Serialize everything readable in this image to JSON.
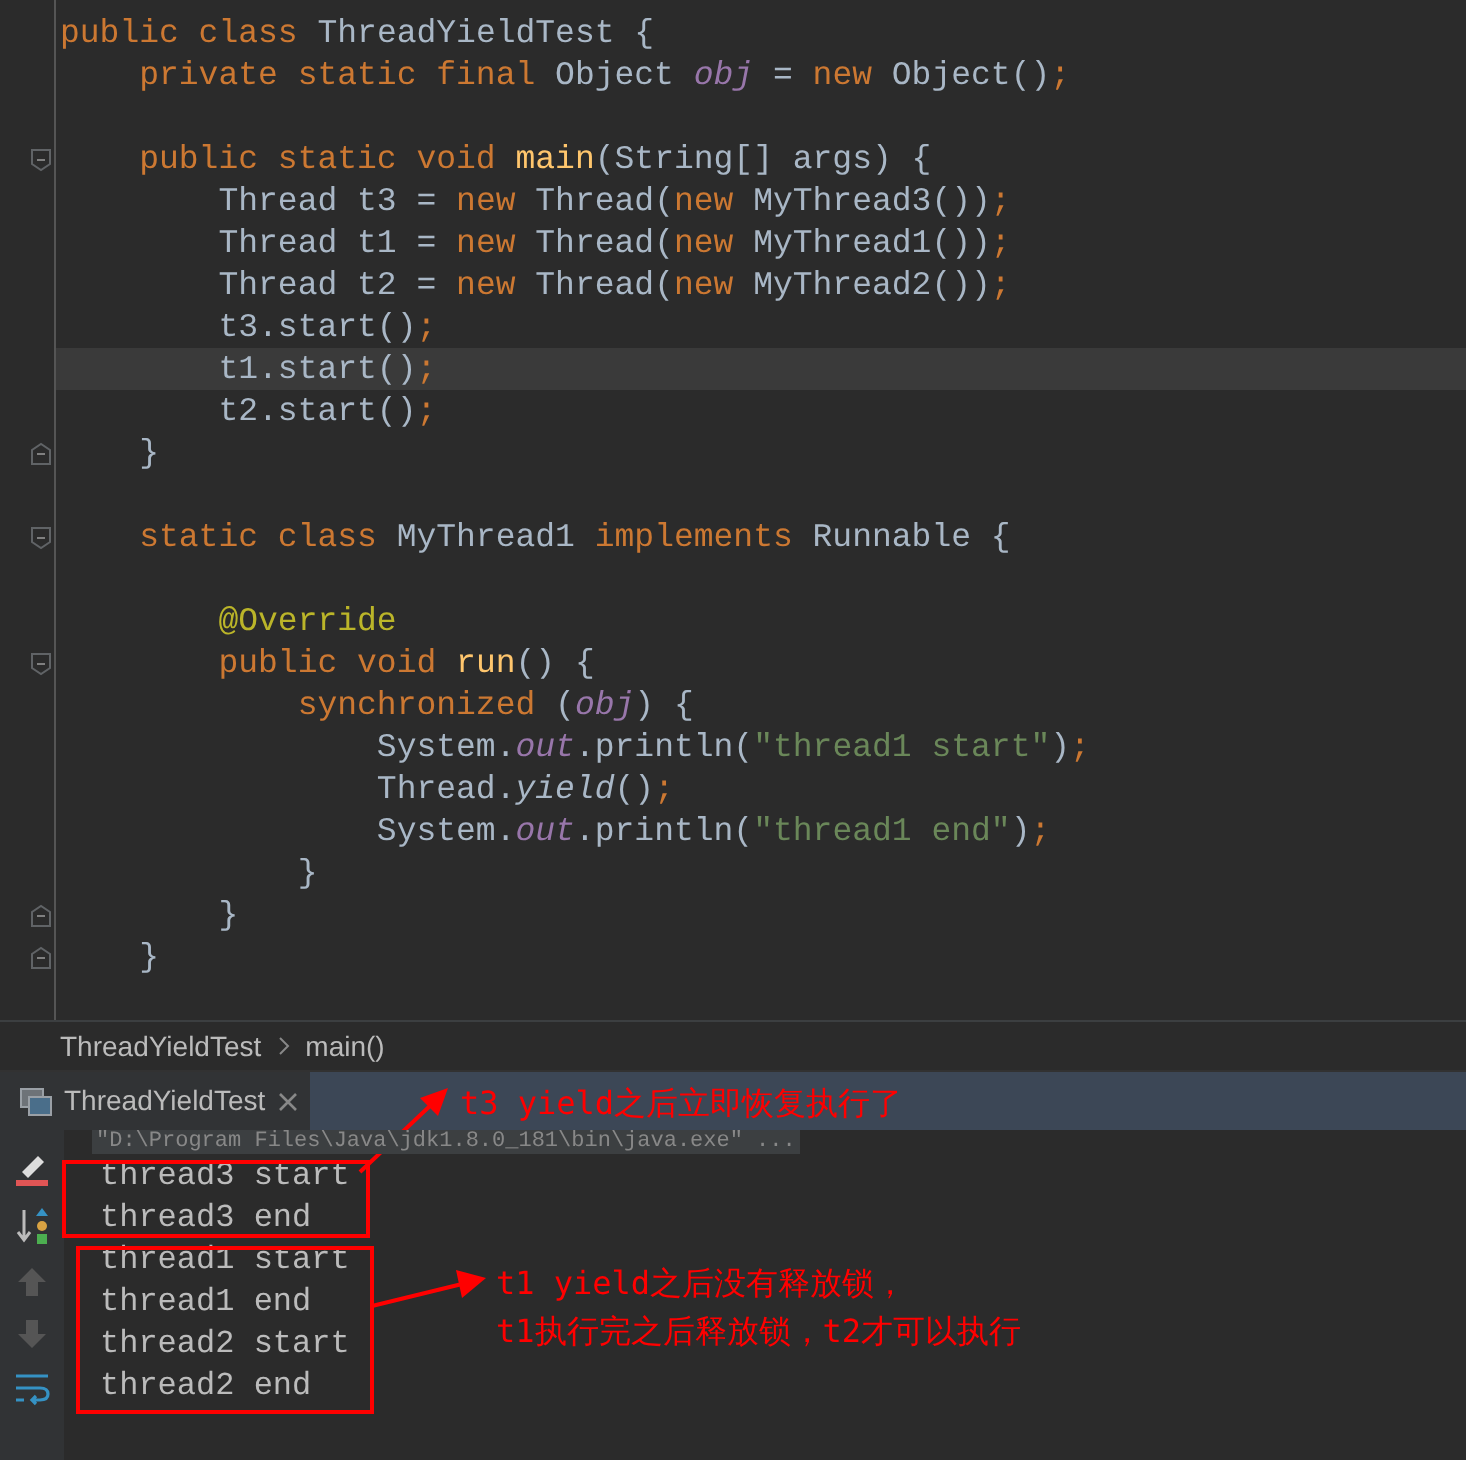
{
  "editor": {
    "lines": [
      {
        "tokens": [
          {
            "kind": "keyword",
            "text": "public class "
          },
          {
            "kind": "plain",
            "text": "ThreadYieldTest {"
          }
        ]
      },
      {
        "tokens": [
          {
            "kind": "keyword",
            "text": "    private static final "
          },
          {
            "kind": "plain",
            "text": "Object "
          },
          {
            "kind": "field",
            "text": "obj"
          },
          {
            "kind": "plain",
            "text": " = "
          },
          {
            "kind": "keyword",
            "text": "new "
          },
          {
            "kind": "plain",
            "text": "Object()"
          },
          {
            "kind": "keyword",
            "text": ";"
          }
        ]
      },
      {
        "kind": "blank"
      },
      {
        "kind": "fold-start",
        "tokens": [
          {
            "kind": "keyword",
            "text": "    public static void "
          },
          {
            "kind": "method",
            "text": "main"
          },
          {
            "kind": "plain",
            "text": "(String[] args) {"
          }
        ]
      },
      {
        "tokens": [
          {
            "kind": "plain",
            "text": "        Thread t3 = "
          },
          {
            "kind": "keyword",
            "text": "new "
          },
          {
            "kind": "plain",
            "text": "Thread("
          },
          {
            "kind": "keyword",
            "text": "new "
          },
          {
            "kind": "plain",
            "text": "MyThread3())"
          },
          {
            "kind": "keyword",
            "text": ";"
          }
        ]
      },
      {
        "tokens": [
          {
            "kind": "plain",
            "text": "        Thread t1 = "
          },
          {
            "kind": "keyword",
            "text": "new "
          },
          {
            "kind": "plain",
            "text": "Thread("
          },
          {
            "kind": "keyword",
            "text": "new "
          },
          {
            "kind": "plain",
            "text": "MyThread1())"
          },
          {
            "kind": "keyword",
            "text": ";"
          }
        ]
      },
      {
        "tokens": [
          {
            "kind": "plain",
            "text": "        Thread t2 = "
          },
          {
            "kind": "keyword",
            "text": "new "
          },
          {
            "kind": "plain",
            "text": "Thread("
          },
          {
            "kind": "keyword",
            "text": "new "
          },
          {
            "kind": "plain",
            "text": "MyThread2())"
          },
          {
            "kind": "keyword",
            "text": ";"
          }
        ]
      },
      {
        "tokens": [
          {
            "kind": "plain",
            "text": "        t3.start()"
          },
          {
            "kind": "keyword",
            "text": ";"
          }
        ]
      },
      {
        "highlighted": true,
        "tokens": [
          {
            "kind": "plain",
            "text": "        t1.start()"
          },
          {
            "kind": "keyword",
            "text": ";"
          }
        ]
      },
      {
        "tokens": [
          {
            "kind": "plain",
            "text": "        t2.start()"
          },
          {
            "kind": "keyword",
            "text": ";"
          }
        ]
      },
      {
        "kind": "fold-end",
        "tokens": [
          {
            "kind": "plain",
            "text": "    }"
          }
        ]
      },
      {
        "kind": "blank"
      },
      {
        "kind": "fold-start",
        "tokens": [
          {
            "kind": "keyword",
            "text": "    static class "
          },
          {
            "kind": "plain",
            "text": "MyThread1 "
          },
          {
            "kind": "keyword",
            "text": "implements "
          },
          {
            "kind": "plain",
            "text": "Runnable {"
          }
        ]
      },
      {
        "kind": "blank"
      },
      {
        "tokens": [
          {
            "kind": "annotation",
            "text": "        @Override"
          }
        ]
      },
      {
        "kind": "fold-start",
        "tokens": [
          {
            "kind": "keyword",
            "text": "        public void "
          },
          {
            "kind": "method",
            "text": "run"
          },
          {
            "kind": "plain",
            "text": "() {"
          }
        ]
      },
      {
        "tokens": [
          {
            "kind": "keyword",
            "text": "            synchronized "
          },
          {
            "kind": "plain",
            "text": "("
          },
          {
            "kind": "field",
            "text": "obj"
          },
          {
            "kind": "plain",
            "text": ") {"
          }
        ]
      },
      {
        "tokens": [
          {
            "kind": "plain",
            "text": "                System."
          },
          {
            "kind": "field",
            "text": "out"
          },
          {
            "kind": "plain",
            "text": ".println("
          },
          {
            "kind": "string",
            "text": "\"thread1 start\""
          },
          {
            "kind": "plain",
            "text": ")"
          },
          {
            "kind": "keyword",
            "text": ";"
          }
        ]
      },
      {
        "tokens": [
          {
            "kind": "plain",
            "text": "                Thread."
          },
          {
            "kind": "static-call",
            "text": "yield"
          },
          {
            "kind": "plain",
            "text": "()"
          },
          {
            "kind": "keyword",
            "text": ";"
          }
        ]
      },
      {
        "tokens": [
          {
            "kind": "plain",
            "text": "                System."
          },
          {
            "kind": "field",
            "text": "out"
          },
          {
            "kind": "plain",
            "text": ".println("
          },
          {
            "kind": "string",
            "text": "\"thread1 end\""
          },
          {
            "kind": "plain",
            "text": ")"
          },
          {
            "kind": "keyword",
            "text": ";"
          }
        ]
      },
      {
        "tokens": [
          {
            "kind": "plain",
            "text": "            }"
          }
        ]
      },
      {
        "kind": "fold-end",
        "tokens": [
          {
            "kind": "plain",
            "text": "        }"
          }
        ]
      },
      {
        "kind": "fold-end",
        "tokens": [
          {
            "kind": "plain",
            "text": "    }"
          }
        ]
      },
      {
        "kind": "blank"
      }
    ]
  },
  "breadcrumbs": [
    "ThreadYieldTest",
    "main()"
  ],
  "run_tab": {
    "label": "ThreadYieldTest",
    "selected": true
  },
  "console": {
    "command": "\"D:\\Program Files\\Java\\jdk1.8.0_181\\bin\\java.exe\" ...",
    "lines": [
      "thread3 start",
      "thread3 end",
      "thread1 start",
      "thread1 end",
      "thread2 start",
      "thread2 end"
    ]
  },
  "annotations": [
    {
      "lines": [
        "t3 yield之后立即恢复执行了"
      ]
    },
    {
      "lines": [
        "t1 yield之后没有释放锁，",
        "t1执行完之后释放锁，t2才可以执行"
      ]
    }
  ]
}
